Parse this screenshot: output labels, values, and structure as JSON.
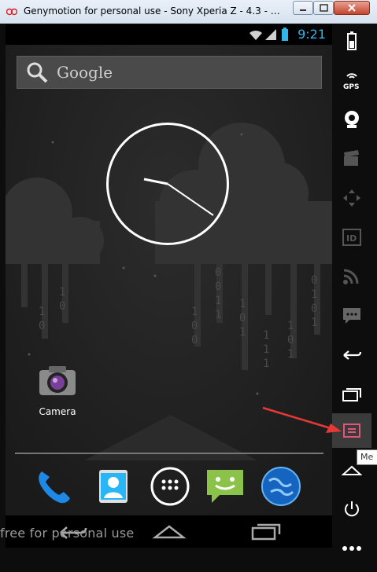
{
  "window": {
    "title": "Genymotion for personal use - Sony Xperia Z - 4.3 - API ..."
  },
  "statusbar": {
    "time": "9:21"
  },
  "search": {
    "label": "Google"
  },
  "home": {
    "clock_time": "9:21",
    "camera_label": "Camera"
  },
  "dock": [
    "phone-icon",
    "people-icon",
    "app-drawer-icon",
    "messaging-icon",
    "browser-icon"
  ],
  "watermark": "free for personal use",
  "toolbar": {
    "items": [
      "battery-icon",
      "gps-icon",
      "webcam-icon",
      "capture-icon",
      "dpad-icon",
      "id-icon",
      "rss-icon",
      "sms-icon",
      "back-icon",
      "recent-apps-icon",
      "menu-icon",
      "home-icon",
      "power-icon",
      "more-icon"
    ],
    "tooltip": "Me"
  },
  "colors": {
    "accent": "#33b5e5",
    "annotation_arrow": "#e53935",
    "menu_icon": "#e0567a"
  }
}
